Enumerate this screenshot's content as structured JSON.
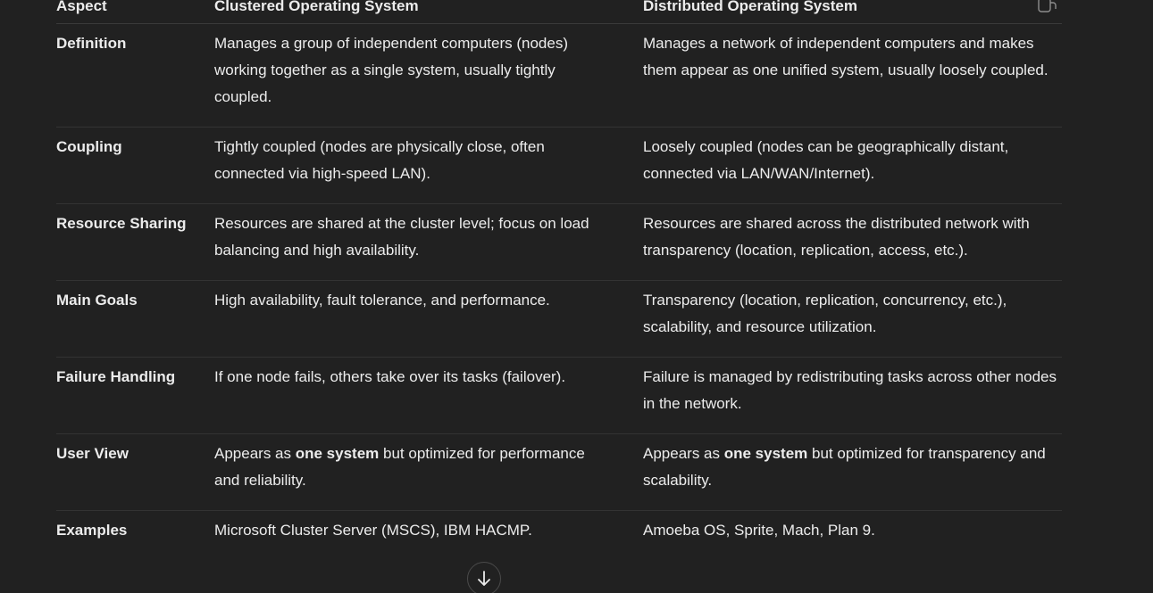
{
  "table": {
    "headers": [
      "Aspect",
      "Clustered Operating System",
      "Distributed Operating System"
    ],
    "rows": [
      {
        "aspect": "Definition",
        "clustered": "Manages a group of independent computers (nodes) working together as a single system, usually tightly coupled.",
        "distributed": "Manages a network of independent computers and makes them appear as one unified system, usually loosely coupled."
      },
      {
        "aspect": "Coupling",
        "clustered": "Tightly coupled (nodes are physically close, often connected via high-speed LAN).",
        "distributed": "Loosely coupled (nodes can be geographically distant, connected via LAN/WAN/Internet)."
      },
      {
        "aspect": "Resource Sharing",
        "clustered": "Resources are shared at the cluster level; focus on load balancing and high availability.",
        "distributed": "Resources are shared across the distributed network with transparency (location, replication, access, etc.)."
      },
      {
        "aspect": "Main Goals",
        "clustered": "High availability, fault tolerance, and performance.",
        "distributed": "Transparency (location, replication, concurrency, etc.), scalability, and resource utilization."
      },
      {
        "aspect": "Failure Handling",
        "clustered": "If one node fails, others take over its tasks (failover).",
        "distributed": "Failure is managed by redistributing tasks across other nodes in the network."
      },
      {
        "aspect": "User View",
        "clustered_pre": "Appears as ",
        "clustered_bold": "one system",
        "clustered_post": " but optimized for performance and reliability.",
        "distributed_pre": "Appears as ",
        "distributed_bold": "one system",
        "distributed_post": " but optimized for transparency and scalability."
      },
      {
        "aspect": "Examples",
        "clustered": "Microsoft Cluster Server (MSCS), IBM HACMP.",
        "distributed": "Amoeba OS, Sprite, Mach, Plan 9."
      }
    ]
  },
  "icons": {
    "copy": "copy-icon",
    "scroll_down": "arrow-down-icon"
  },
  "colors": {
    "background": "#212121",
    "text": "#ececec",
    "divider": "#333333"
  }
}
